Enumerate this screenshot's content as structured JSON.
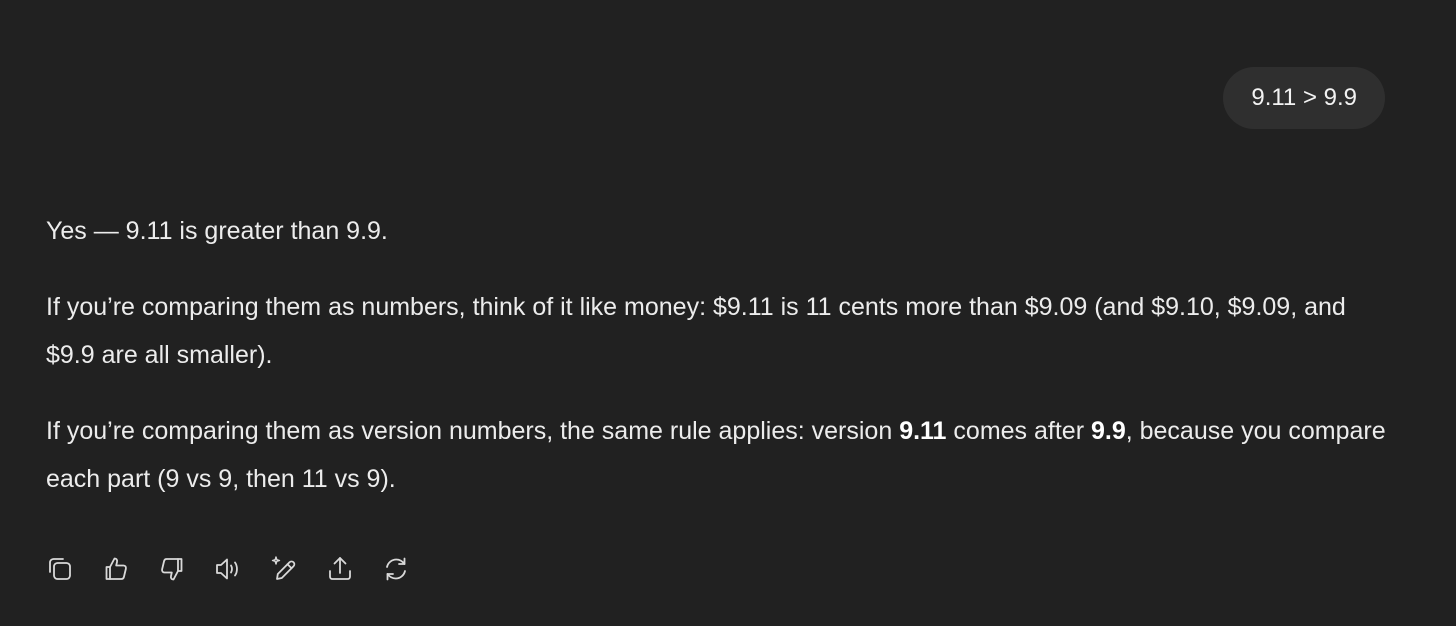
{
  "user_message": "9.11 > 9.9",
  "assistant": {
    "p1": "Yes — 9.11 is greater than 9.9.",
    "p2": "If you’re comparing them as numbers, think of it like money: $9.11 is 11 cents more than $9.09 (and $9.10, $9.09, and $9.9 are all smaller).",
    "p3_pre": "If you’re comparing them as version numbers, the same rule applies: version ",
    "p3_bold1": "9.11",
    "p3_mid": " comes after ",
    "p3_bold2": "9.9",
    "p3_post": ", because you compare each part (9 vs 9, then 11 vs 9)."
  },
  "actions": [
    {
      "name": "copy-icon"
    },
    {
      "name": "thumbs-up-icon"
    },
    {
      "name": "thumbs-down-icon"
    },
    {
      "name": "read-aloud-icon"
    },
    {
      "name": "edit-sparkle-icon"
    },
    {
      "name": "share-icon"
    },
    {
      "name": "regenerate-icon"
    }
  ],
  "colors": {
    "background": "#212121",
    "bubble": "#2f2f2f",
    "text": "#ececec"
  }
}
